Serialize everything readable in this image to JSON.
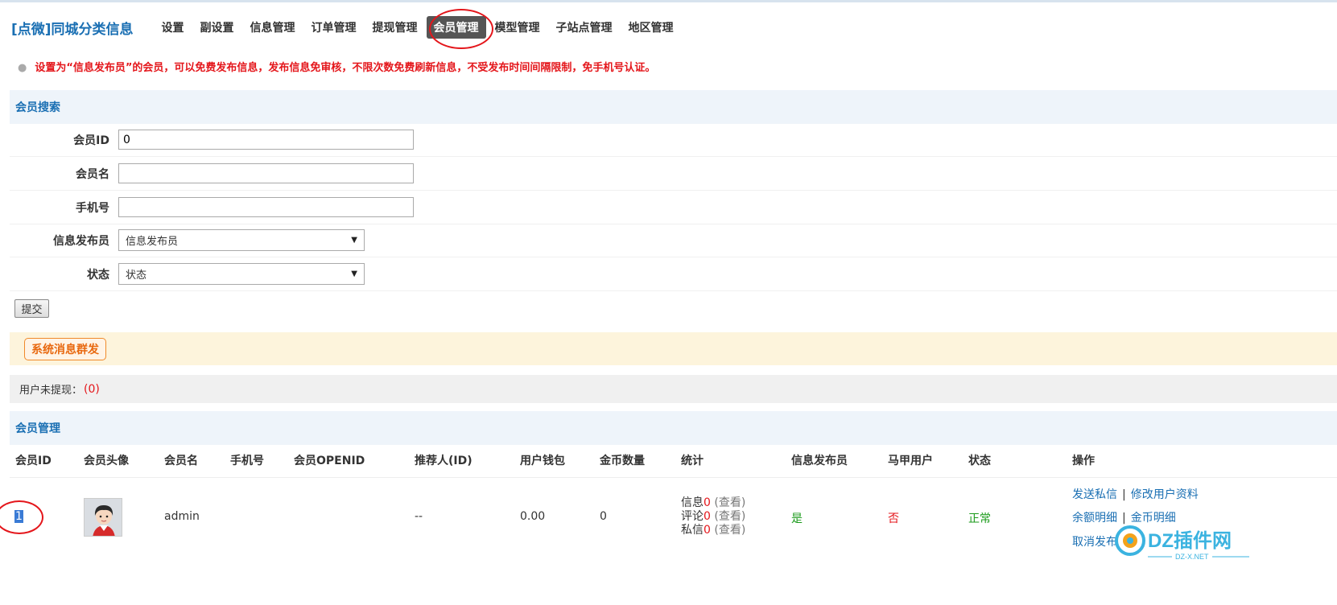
{
  "header": {
    "brand": "[点微]同城分类信息",
    "nav": [
      "设置",
      "副设置",
      "信息管理",
      "订单管理",
      "提现管理",
      "会员管理",
      "模型管理",
      "子站点管理",
      "地区管理"
    ],
    "active_tab": "会员管理"
  },
  "notice": "设置为“信息发布员”的会员，可以免费发布信息，发布信息免审核，不限次数免费刷新信息，不受发布时间间隔限制，免手机号认证。",
  "search": {
    "title": "会员搜索",
    "member_id_label": "会员ID",
    "member_id_value": "0",
    "member_name_label": "会员名",
    "member_name_value": "",
    "phone_label": "手机号",
    "phone_value": "",
    "publisher_label": "信息发布员",
    "publisher_selected": "信息发布员",
    "status_label": "状态",
    "status_selected": "状态",
    "submit": "提交"
  },
  "broadcast_button": "系统消息群发",
  "withdraw": {
    "label": "用户未提现：",
    "count": "(0)"
  },
  "table": {
    "title": "会员管理",
    "headers": [
      "会员ID",
      "会员头像",
      "会员名",
      "手机号",
      "会员OPENID",
      "推荐人(ID)",
      "用户钱包",
      "金币数量",
      "统计",
      "信息发布员",
      "马甲用户",
      "状态",
      "操作"
    ],
    "rows": [
      {
        "id": "1",
        "name": "admin",
        "phone": "",
        "openid": "",
        "referrer": "--",
        "wallet": "0.00",
        "coins": "0",
        "stats": [
          {
            "label": "信息",
            "count": "0",
            "link": "(查看)"
          },
          {
            "label": "评论",
            "count": "0",
            "link": "(查看)"
          },
          {
            "label": "私信",
            "count": "0",
            "link": "(查看)"
          }
        ],
        "publisher": "是",
        "sockpuppet": "否",
        "status": "正常",
        "ops": {
          "send_message": "发送私信",
          "edit_profile": "修改用户资料",
          "balance_detail": "余额明细",
          "coin_detail": "金币明细",
          "cancel_publisher": "取消发布员"
        }
      }
    ]
  },
  "colors": {
    "accent_blue": "#1a6fb3",
    "alert_red": "#e4161b",
    "green": "#1a9a1a",
    "orange": "#f08a2a"
  },
  "watermark": {
    "text": "DZ插件网",
    "sub": "DZ-X.NET"
  }
}
